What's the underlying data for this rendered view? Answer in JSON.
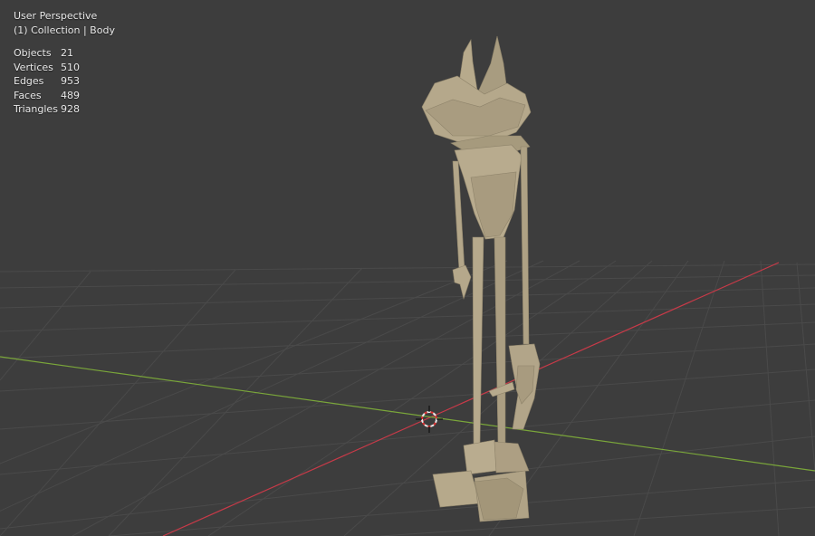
{
  "viewport": {
    "perspective_label": "User Perspective",
    "collection_label": "(1) Collection | Body",
    "background_color": "#3d3d3d",
    "grid_color": "#4a4a4a",
    "x_axis_color": "#c83a48",
    "y_axis_color": "#7aa63a",
    "model_color": "#b2a589"
  },
  "stats": [
    {
      "label": "Objects",
      "value": "21"
    },
    {
      "label": "Vertices",
      "value": "510"
    },
    {
      "label": "Edges",
      "value": "953"
    },
    {
      "label": "Faces",
      "value": "489"
    },
    {
      "label": "Triangles",
      "value": "928"
    }
  ]
}
